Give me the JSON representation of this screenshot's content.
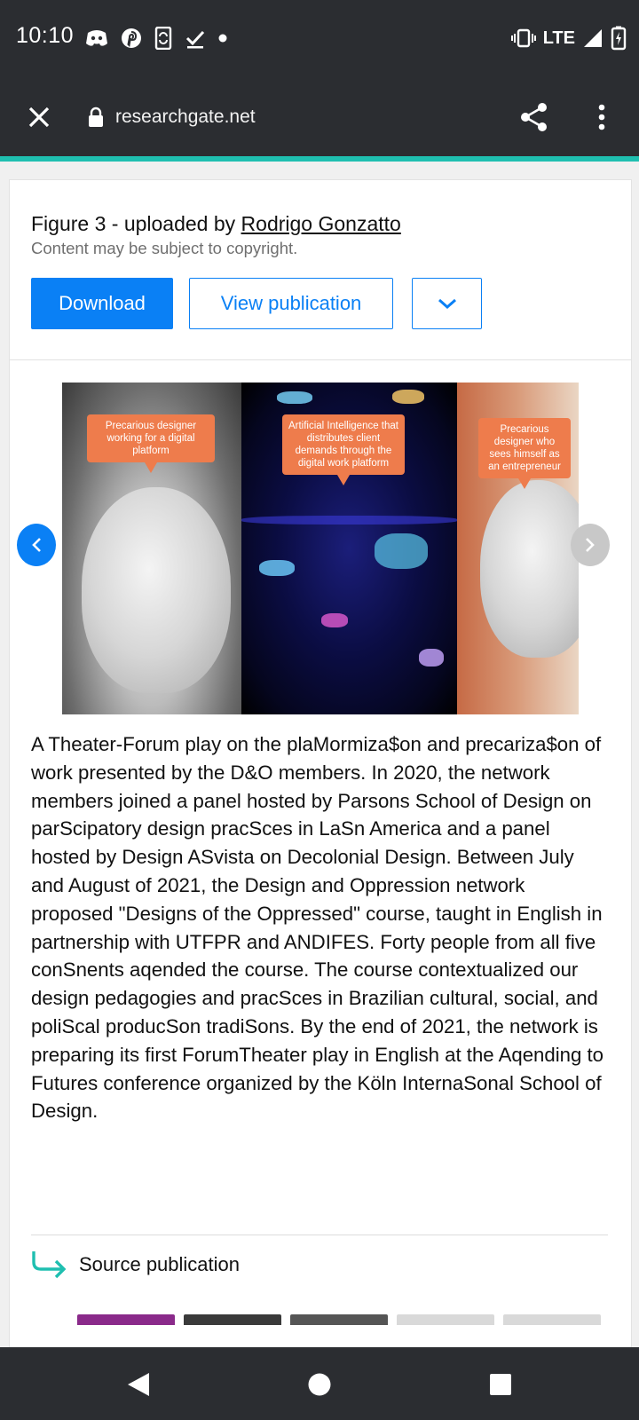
{
  "status_bar": {
    "time": "10:10",
    "network": "LTE",
    "left_icons": [
      "discord-icon",
      "pinterest-icon",
      "phone-sync-icon",
      "checkmark-icon",
      "dot-icon"
    ],
    "right_icons": [
      "vibrate-icon",
      "signal-icon",
      "battery-charging-icon"
    ]
  },
  "toolbar": {
    "url": "researchgate.net",
    "close_icon": "close-icon",
    "lock_icon": "lock-icon",
    "share_icon": "share-icon",
    "menu_icon": "more-vert-icon"
  },
  "card": {
    "figure_prefix": "Figure 3 - uploaded by ",
    "uploader": "Rodrigo Gonzatto",
    "copyright": "Content may be subject to copyright.",
    "buttons": {
      "download": "Download",
      "view_publication": "View publication"
    },
    "image": {
      "bubble_1": "Precarious designer working for a digital platform",
      "bubble_2": "Artificial Intelligence that distributes client demands through the digital work platform",
      "bubble_3": "Precarious designer who sees himself as an entrepreneur"
    },
    "caption": "A Theater-Forum play on the plaMormiza$on and precariza$on of work presented by the D&O members. In 2020, the network members joined a panel hosted by Parsons School of Design on parScipatory design pracSces in LaSn America and a panel hosted by Design ASvista on Decolonial Design. Between July and August of 2021, the Design and Oppression network proposed \"Designs of the Oppressed\" course, taught in English in partnership with UTFPR and ANDIFES. Forty people from all five conSnents aqended the course. The course contextualized our design pedagogies and pracSces in Brazilian cultural, social, and poliScal producSon tradiSons. By the end of 2021, the network is preparing its first ForumTheater play in English at the Aqending to Futures conference organized by the Köln InternaSonal School of Design.",
    "source_label": "Source publication"
  },
  "colors": {
    "accent": "#0a80f5",
    "teal": "#1fbfb0",
    "chrome_bg": "#2b2d31",
    "bubble": "#ee7c4c"
  }
}
